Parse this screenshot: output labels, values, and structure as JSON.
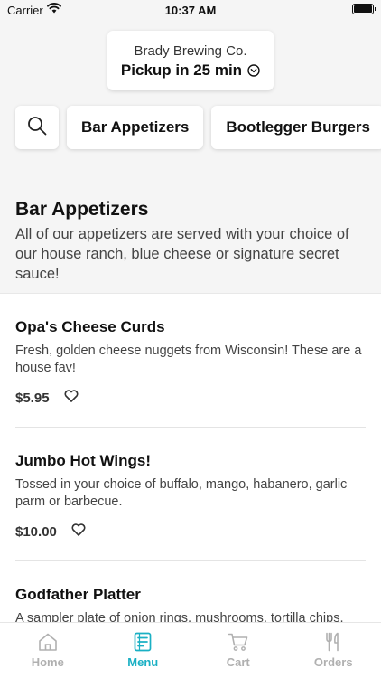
{
  "status_bar": {
    "carrier": "Carrier",
    "time": "10:37 AM"
  },
  "store": {
    "name": "Brady Brewing Co.",
    "pickup": "Pickup in 25 min"
  },
  "categories": [
    {
      "label": "Bar Appetizers"
    },
    {
      "label": "Bootlegger Burgers"
    }
  ],
  "section": {
    "title": "Bar Appetizers",
    "description": "All of our appetizers are served with your choice of our house ranch, blue cheese or signature secret sauce!"
  },
  "items": [
    {
      "name": "Opa's Cheese Curds",
      "description": "Fresh, golden cheese nuggets from Wisconsin! These are a house fav!",
      "price": "$5.95"
    },
    {
      "name": "Jumbo Hot Wings!",
      "description": "Tossed in your choice of buffalo, mango, habanero, garlic parm or barbecue.",
      "price": "$10.00"
    },
    {
      "name": "Godfather Platter",
      "description": "A sampler plate of onion rings, mushrooms, tortilla chips,",
      "price": ""
    }
  ],
  "tabs": [
    {
      "label": "Home",
      "icon": "home-icon",
      "active": false
    },
    {
      "label": "Menu",
      "icon": "menu-icon",
      "active": true
    },
    {
      "label": "Cart",
      "icon": "cart-icon",
      "active": false
    },
    {
      "label": "Orders",
      "icon": "orders-icon",
      "active": false
    }
  ],
  "colors": {
    "accent": "#1ab0c4",
    "inactive_tab": "#b0b0b0",
    "background": "#f5f5f5"
  }
}
